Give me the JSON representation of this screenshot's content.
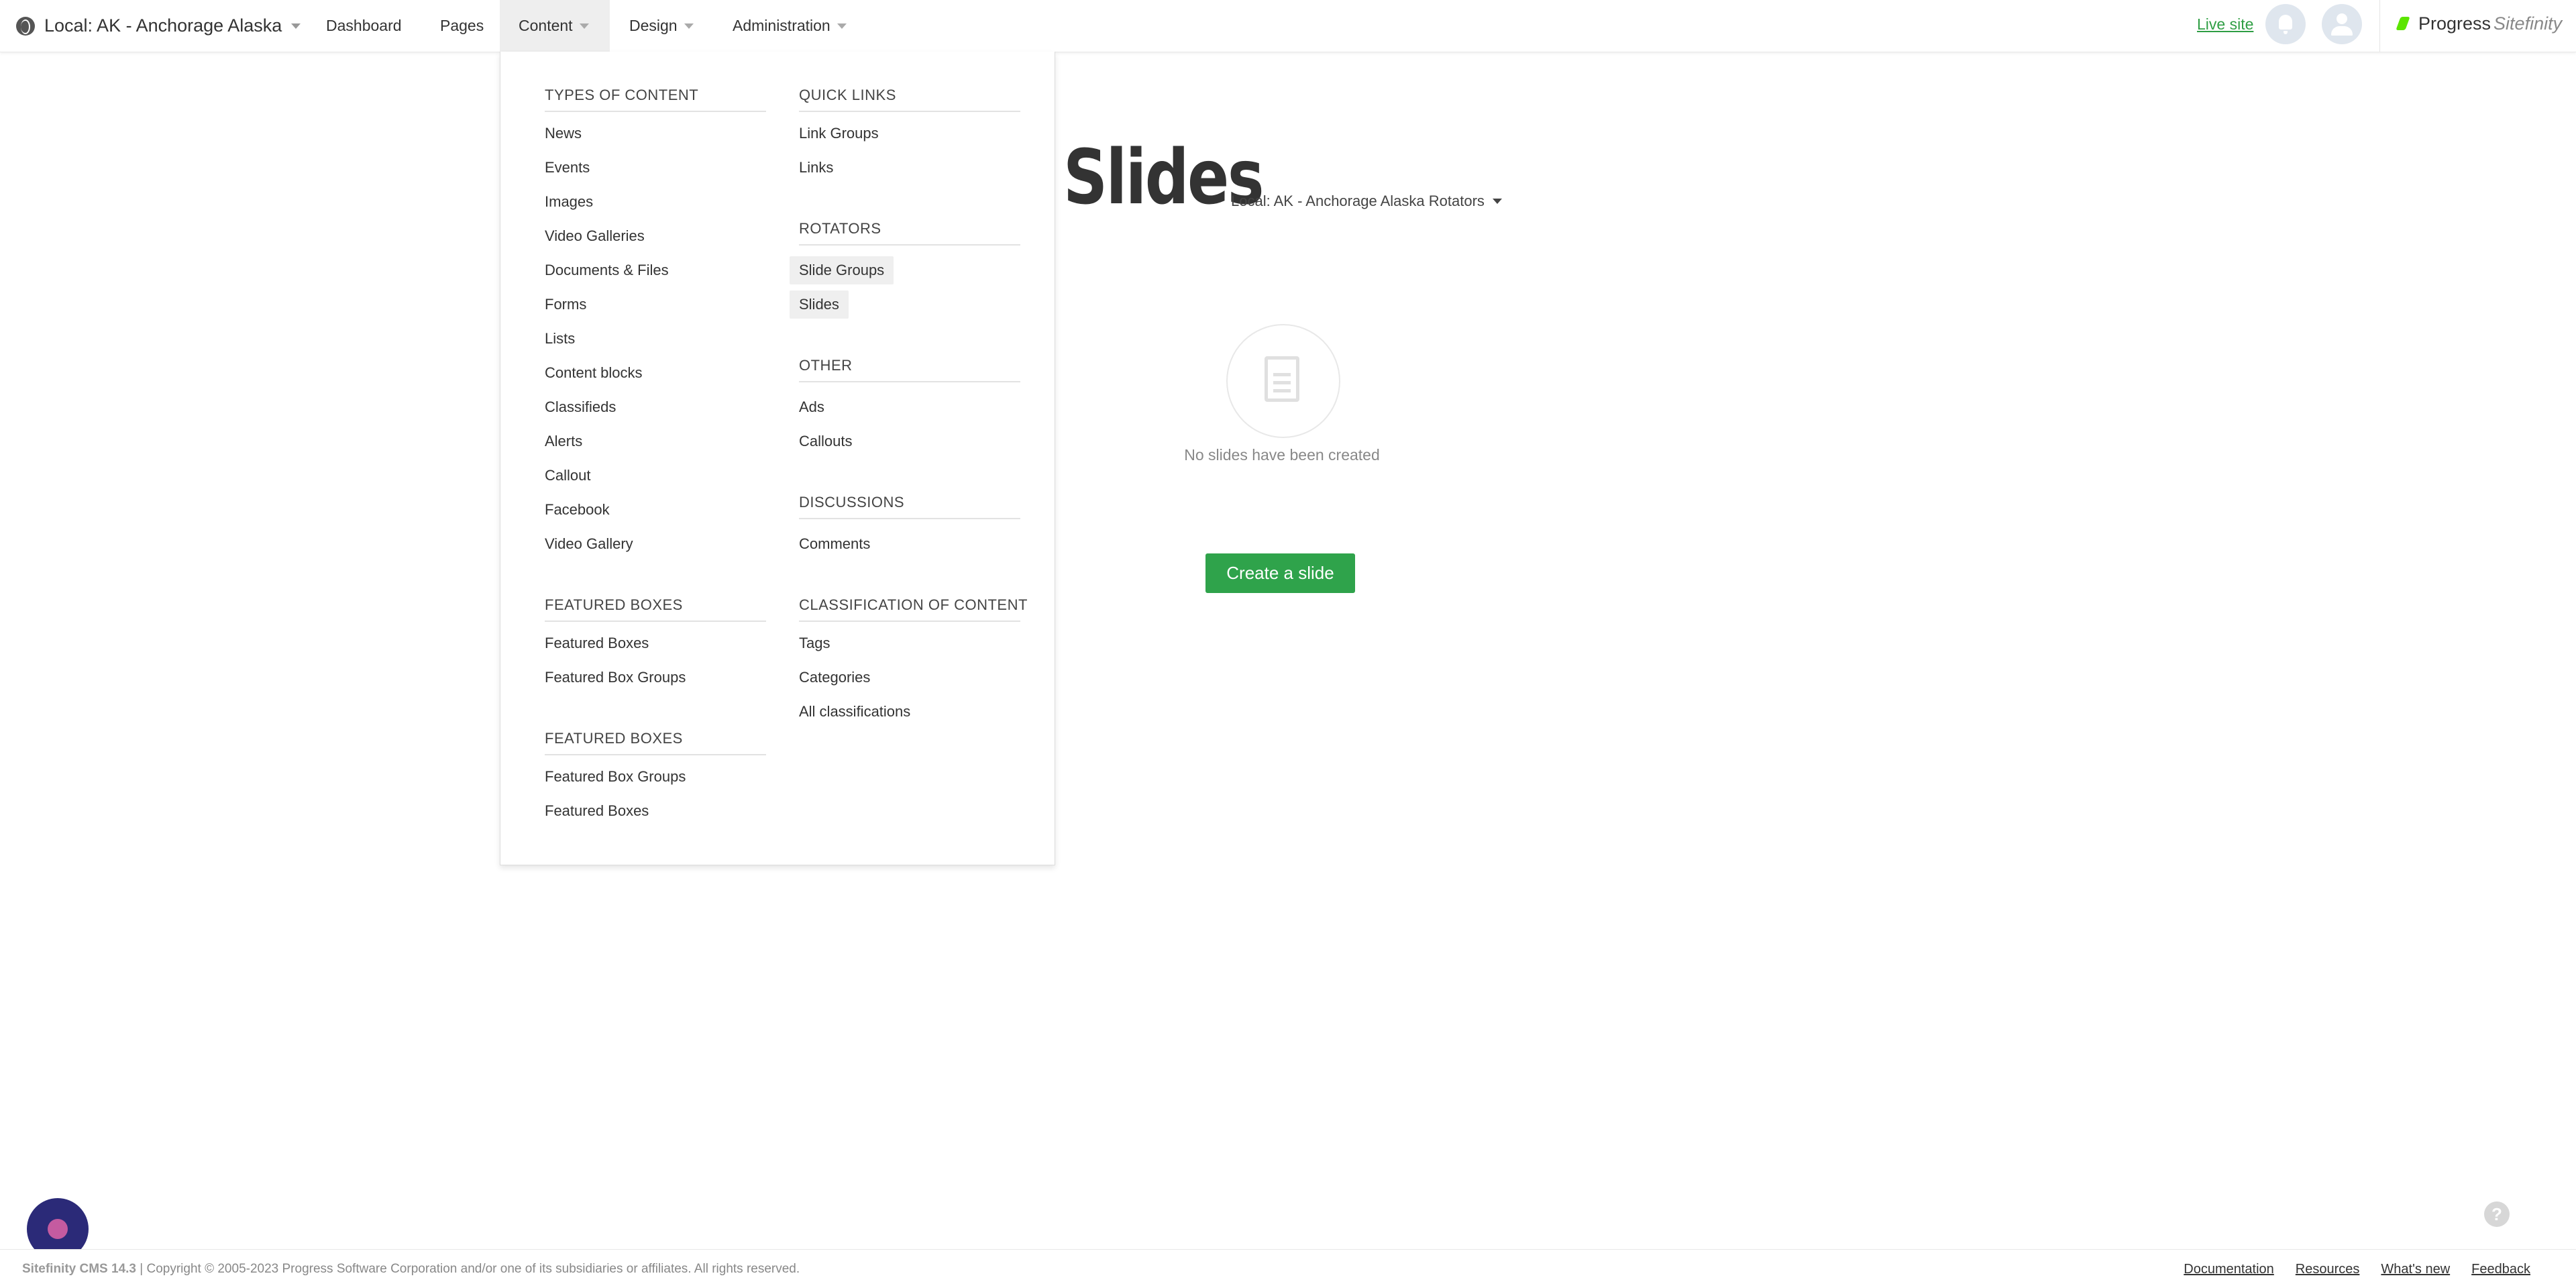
{
  "header": {
    "site_name": "Local: AK - Anchorage Alaska",
    "nav": [
      {
        "label": "Dashboard"
      },
      {
        "label": "Pages"
      },
      {
        "label": "Content"
      },
      {
        "label": "Design"
      },
      {
        "label": "Administration"
      }
    ],
    "live_site": "Live site",
    "brand_progress": "Progress",
    "brand_sitefinity": "Sitefinity"
  },
  "main": {
    "title": "Slides",
    "site_filter": "Local: AK - Anchorage Alaska Rotators",
    "empty_text": "No slides have been created",
    "create_button": "Create a slide"
  },
  "content_menu": {
    "col1": [
      {
        "heading": "TYPES OF CONTENT",
        "items": [
          "News",
          "Events",
          "Images",
          "Video Galleries",
          "Documents & Files",
          "Forms",
          "Lists",
          "Content blocks",
          "Classifieds",
          "Alerts",
          "Callout",
          "Facebook",
          "Video Gallery"
        ]
      },
      {
        "heading": "FEATURED BOXES",
        "items": [
          "Featured Boxes",
          "Featured Box Groups"
        ]
      },
      {
        "heading": "FEATURED BOXES",
        "items": [
          "Featured Box Groups",
          "Featured Boxes"
        ]
      }
    ],
    "col2": [
      {
        "heading": "QUICK LINKS",
        "items": [
          "Link Groups",
          "Links"
        ]
      },
      {
        "heading": "ROTATORS",
        "items": [
          "Slide Groups",
          "Slides"
        ]
      },
      {
        "heading": "OTHER",
        "items": [
          "Ads",
          "Callouts"
        ]
      },
      {
        "heading": "DISCUSSIONS",
        "items": [
          "Comments"
        ]
      },
      {
        "heading": "CLASSIFICATION OF CONTENT",
        "items": [
          "Tags",
          "Categories",
          "All classifications"
        ]
      }
    ]
  },
  "footer": {
    "product": "Sitefinity CMS 14.3",
    "copyright": " | Copyright © 2005-2023 Progress Software Corporation and/or one of its subsidiaries or affiliates. All rights reserved.",
    "links": [
      "Documentation",
      "Resources",
      "What's new",
      "Feedback"
    ]
  },
  "colors": {
    "accent_green": "#2fa34b",
    "live_site_green": "#2f9e44",
    "chat_bubble": "#2b2a78"
  }
}
